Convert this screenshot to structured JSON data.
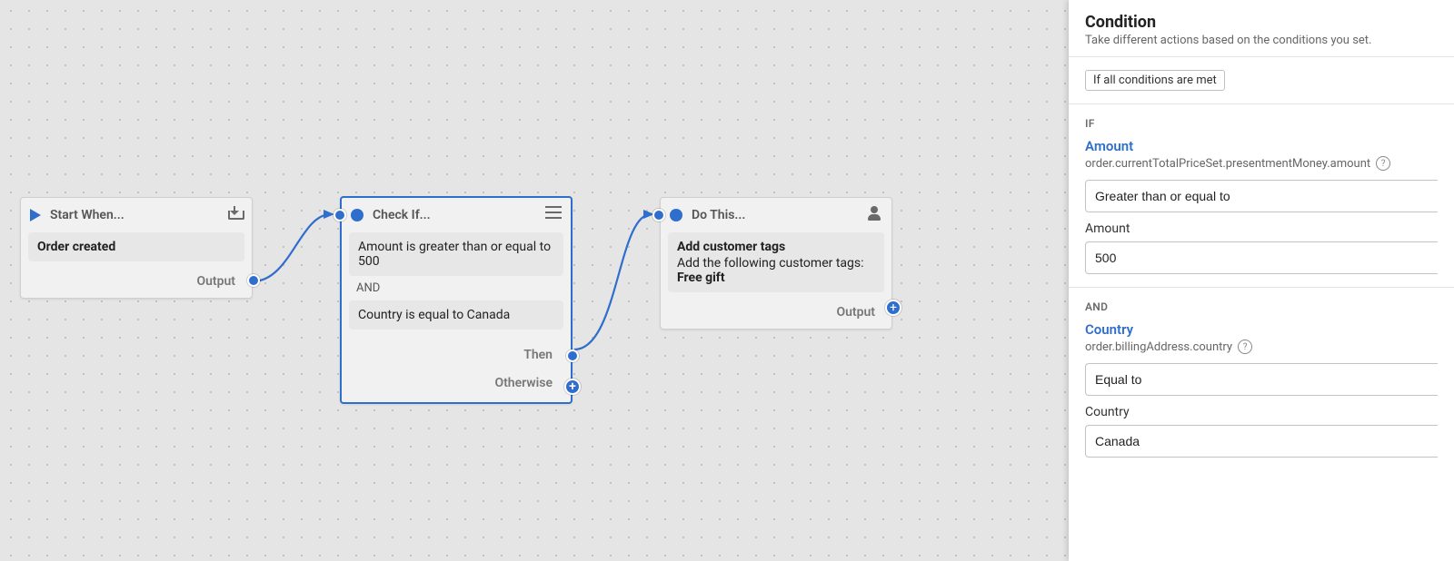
{
  "nodes": {
    "start": {
      "header": "Start When...",
      "trigger": "Order created",
      "output_label": "Output"
    },
    "condition": {
      "header": "Check If...",
      "rule1": "Amount is greater than or equal to 500",
      "join": "AND",
      "rule2": "Country is equal to Canada",
      "then_label": "Then",
      "otherwise_label": "Otherwise"
    },
    "action": {
      "header": "Do This...",
      "title": "Add customer tags",
      "desc": "Add the following customer tags:",
      "tag": "Free gift",
      "output_label": "Output"
    }
  },
  "sidebar": {
    "title": "Condition",
    "subtitle": "Take different actions based on the conditions you set.",
    "match_chip": "If all conditions are met",
    "if_label": "IF",
    "and_label": "AND",
    "cond1": {
      "field_link": "Amount",
      "field_path": "order.currentTotalPriceSet.presentmentMoney.amount",
      "operator": "Greater than or equal to",
      "value_label": "Amount",
      "value": "500"
    },
    "cond2": {
      "field_link": "Country",
      "field_path": "order.billingAddress.country",
      "operator": "Equal to",
      "value_label": "Country",
      "value": "Canada"
    }
  }
}
